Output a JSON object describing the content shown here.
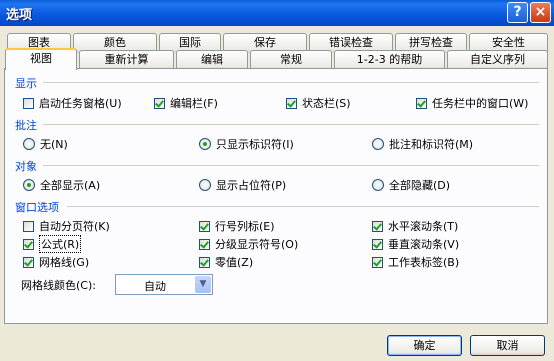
{
  "window": {
    "title": "选项",
    "help_glyph": "?",
    "close_glyph": "×"
  },
  "tabs_row1": [
    "图表",
    "颜色",
    "国际",
    "保存",
    "错误检查",
    "拼写检查",
    "安全性"
  ],
  "tabs_row2": [
    "视图",
    "重新计算",
    "编辑",
    "常规",
    "1-2-3 的帮助",
    "自定义序列"
  ],
  "active_tab": "视图",
  "sections": {
    "display": {
      "label": "显示",
      "items": [
        {
          "label": "启动任务窗格(U)",
          "checked": false
        },
        {
          "label": "编辑栏(F)",
          "checked": true
        },
        {
          "label": "状态栏(S)",
          "checked": true
        },
        {
          "label": "任务栏中的窗口(W)",
          "checked": true
        }
      ]
    },
    "comments": {
      "label": "批注",
      "items": [
        {
          "label": "无(N)",
          "selected": false
        },
        {
          "label": "只显示标识符(I)",
          "selected": true
        },
        {
          "label": "批注和标识符(M)",
          "selected": false
        }
      ]
    },
    "objects": {
      "label": "对象",
      "items": [
        {
          "label": "全部显示(A)",
          "selected": true
        },
        {
          "label": "显示占位符(P)",
          "selected": false
        },
        {
          "label": "全部隐藏(D)",
          "selected": false
        }
      ]
    },
    "window_options": {
      "label": "窗口选项",
      "items": [
        {
          "label": "自动分页符(K)",
          "checked": false
        },
        {
          "label": "行号列标(E)",
          "checked": true
        },
        {
          "label": "水平滚动条(T)",
          "checked": true
        },
        {
          "label": "公式(R)",
          "checked": true
        },
        {
          "label": "分级显示符号(O)",
          "checked": true
        },
        {
          "label": "垂直滚动条(V)",
          "checked": true
        },
        {
          "label": "网格线(G)",
          "checked": true
        },
        {
          "label": "零值(Z)",
          "checked": true
        },
        {
          "label": "工作表标签(B)",
          "checked": true
        }
      ],
      "gridline_color_label": "网格线颜色(C):",
      "gridline_color_value": "自动"
    }
  },
  "buttons": {
    "ok": "确定",
    "cancel": "取消"
  }
}
